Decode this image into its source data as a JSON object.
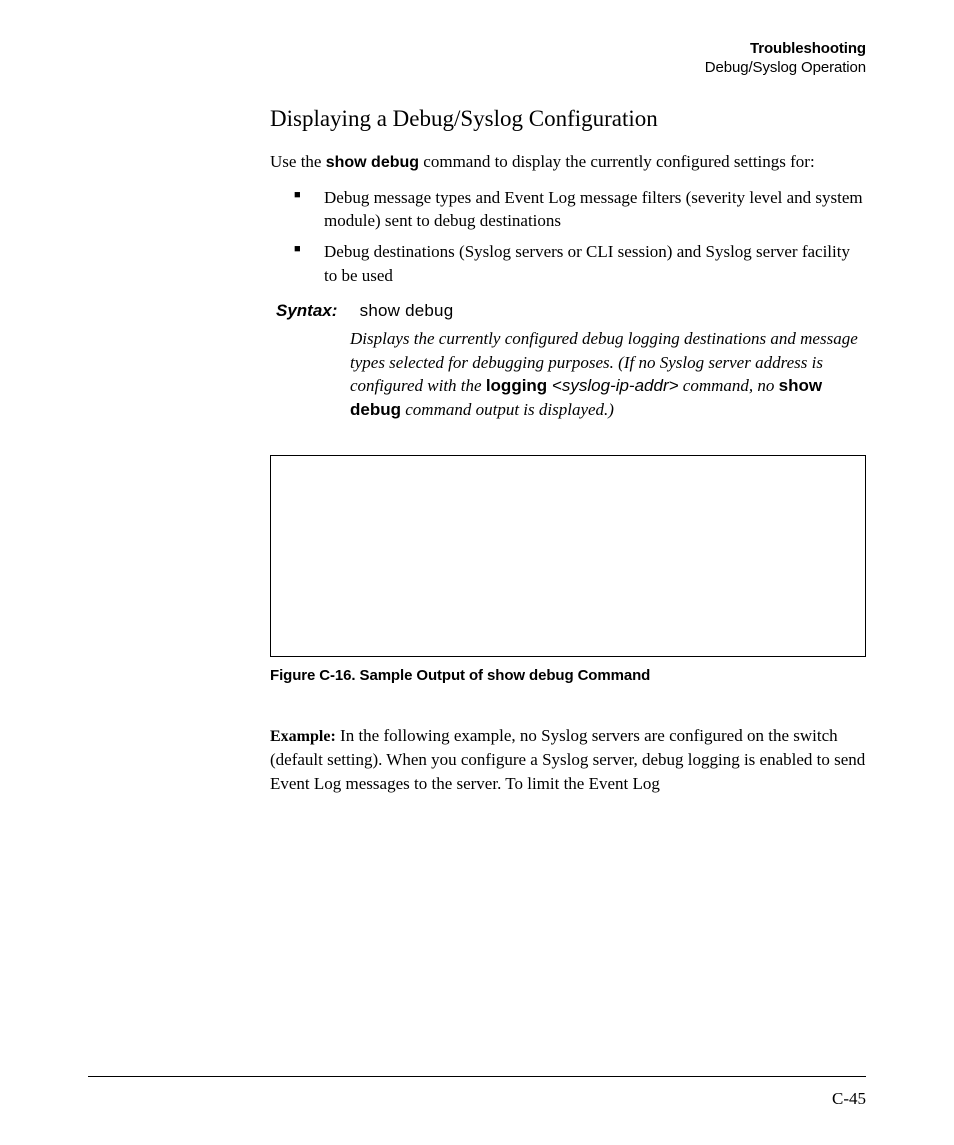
{
  "header": {
    "chapter": "Troubleshooting",
    "section": "Debug/Syslog Operation"
  },
  "title": "Displaying a Debug/Syslog Configuration",
  "intro": {
    "pre": "Use the ",
    "cmd": "show debug",
    "post": " command to display the currently configured settings for:"
  },
  "bullets": [
    "Debug message types and Event Log message filters (severity level and system module) sent to debug destinations",
    "Debug destinations (Syslog servers or CLI session) and Syslog server facility to be used"
  ],
  "syntax": {
    "label": "Syntax:",
    "command": "show debug"
  },
  "desc": {
    "part1": "Displays the currently configured debug logging destinations and message types selected for debugging purposes. (If no Syslog server address is configured with the ",
    "cmd1": "logging",
    "arg": " <syslog-ip-addr>",
    "part2": " command, no ",
    "cmd2": "show debug",
    "part3": " command output is displayed.)"
  },
  "figure_caption": "Figure C-16. Sample Output of show debug Command",
  "example": {
    "label": "Example:",
    "text": " In the following example, no Syslog servers are configured on the switch (default setting). When you configure a Syslog server, debug logging is enabled to send Event Log messages to the server. To limit the Event Log"
  },
  "page_number": "C-45"
}
